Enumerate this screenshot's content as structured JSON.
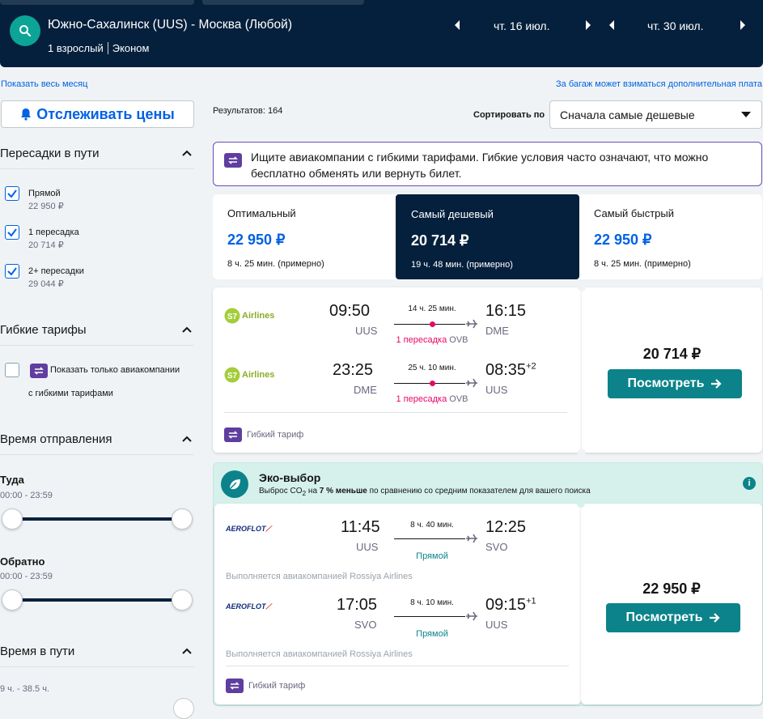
{
  "header": {
    "route": "Южно-Сахалинск (UUS) - Москва (Любой)",
    "passengers": "1 взрослый",
    "cabin": "Эконом",
    "date_out": "чт. 16 июл.",
    "date_back": "чт. 30 июл."
  },
  "links": {
    "show_month": "Показать весь месяц",
    "baggage": "За багаж может взиматься дополнительная плата"
  },
  "sidebar": {
    "track_label": "Отслеживать цены",
    "stops": {
      "title": "Пересадки в пути",
      "options": [
        {
          "label": "Прямой",
          "price": "22 950 ₽",
          "checked": true
        },
        {
          "label": "1 пересадка",
          "price": "20 714 ₽",
          "checked": true
        },
        {
          "label": "2+ пересадки",
          "price": "29 044 ₽",
          "checked": true
        }
      ]
    },
    "flex": {
      "title": "Гибкие тарифы",
      "label_a": "Показать только авиакомпании",
      "label_b": "с гибкими тарифами"
    },
    "departure": {
      "title": "Время отправления",
      "out_label": "Туда",
      "out_range": "00:00 - 23:59",
      "back_label": "Обратно",
      "back_range": "00:00 - 23:59"
    },
    "duration": {
      "title": "Время в пути",
      "range": "9 ч. - 38.5 ч."
    }
  },
  "results": {
    "count": "Результатов: 164",
    "sort_label": "Сортировать по",
    "sort_value": "Сначала самые дешевые"
  },
  "banner": {
    "text": "Ищите авиакомпании с гибкими тарифами. Гибкие условия часто означают, что можно бесплатно обменять или вернуть билет."
  },
  "sort_tabs": [
    {
      "label": "Оптимальный",
      "price": "22 950 ₽",
      "duration": "8 ч. 25 мин. (примерно)"
    },
    {
      "label": "Самый дешевый",
      "price": "20 714 ₽",
      "duration": "19 ч. 48 мин. (примерно)"
    },
    {
      "label": "Самый быстрый",
      "price": "22 950 ₽",
      "duration": "8 ч. 25 мин. (примерно)"
    }
  ],
  "card1": {
    "price": "20 714 ₽",
    "button": "Посмотреть",
    "flex_tag": "Гибкий тариф",
    "legs": [
      {
        "airline": "Airlines",
        "dep_time": "09:50",
        "dep_ap": "UUS",
        "arr_time": "16:15",
        "arr_ap": "DME",
        "duration": "14 ч. 25 мин.",
        "stops": "1 пересадка",
        "via": "OVB",
        "plus": ""
      },
      {
        "airline": "Airlines",
        "dep_time": "23:25",
        "dep_ap": "DME",
        "arr_time": "08:35",
        "arr_ap": "UUS",
        "duration": "25 ч. 10 мин.",
        "stops": "1 пересадка",
        "via": "OVB",
        "plus": "+2"
      }
    ]
  },
  "eco": {
    "title": "Эко-выбор",
    "text_a": "Выброс CO",
    "text_sub": "2",
    "text_b": " на ",
    "text_bold": "7 % меньше",
    "text_c": " по сравнению со средним показателем для вашего поиска"
  },
  "card2": {
    "price": "22 950 ₽",
    "button": "Посмотреть",
    "flex_tag": "Гибкий тариф",
    "operated": "Выполняется авиакомпанией Rossiya Airlines",
    "legs": [
      {
        "airline": "AEROFLOT",
        "dep_time": "11:45",
        "dep_ap": "UUS",
        "arr_time": "12:25",
        "arr_ap": "SVO",
        "duration": "8 ч. 40 мин.",
        "stops": "Прямой",
        "plus": ""
      },
      {
        "airline": "AEROFLOT",
        "dep_time": "17:05",
        "dep_ap": "SVO",
        "arr_time": "09:15",
        "arr_ap": "UUS",
        "duration": "8 ч. 10 мин.",
        "stops": "Прямой",
        "plus": "+1"
      }
    ]
  },
  "colors": {
    "brand": "#05203c",
    "accent": "#0062e3",
    "button": "#0c838a",
    "stop_dot": "#e70866",
    "eco_bg": "#d6f1ec"
  }
}
